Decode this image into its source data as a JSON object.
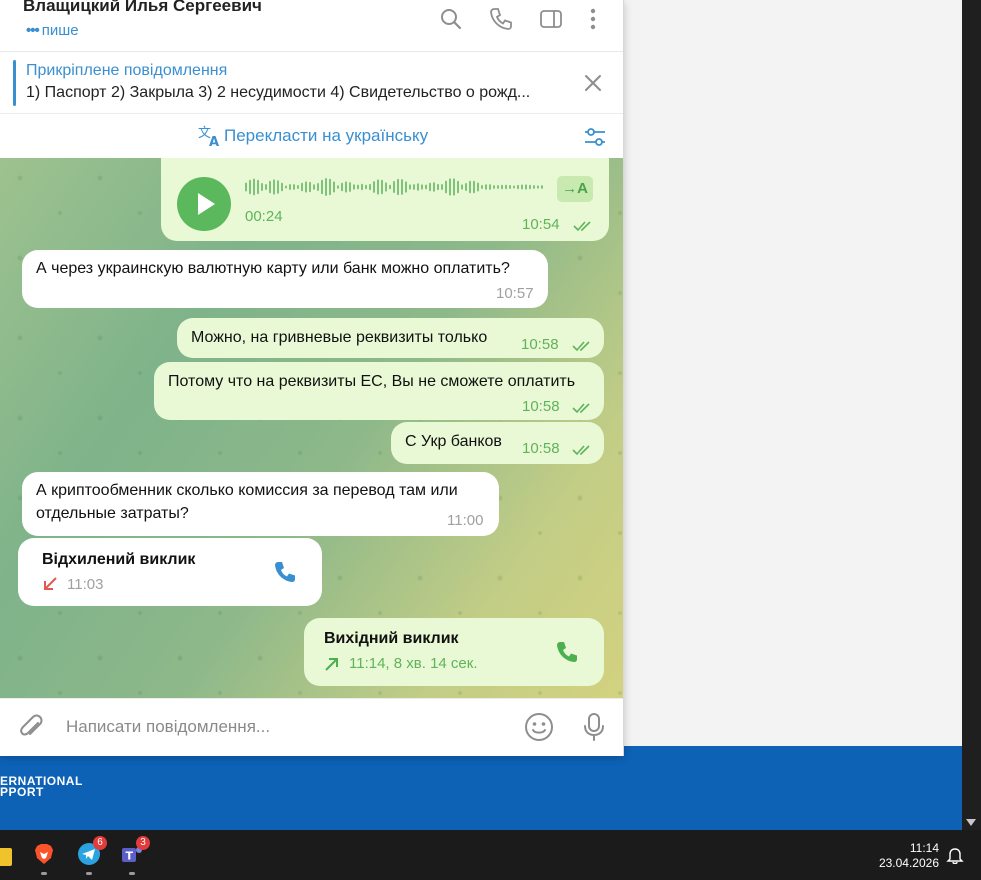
{
  "header": {
    "chat_name": "Влащицкий Илья Сергеевич",
    "status": "пише"
  },
  "pinned": {
    "title": "Прикріплене повідомлення",
    "text": "1) Паспорт 2) Закрыла 3) 2 несудимости 4) Свидетельство о рожд..."
  },
  "translate_bar": {
    "label": "Перекласти на українську"
  },
  "messages": [
    {
      "dir": "out",
      "type": "voice",
      "duration": "00:24",
      "time": "10:54",
      "transcribe": "→A"
    },
    {
      "dir": "in",
      "text": "А через украинскую валютную карту или банк можно оплатить?",
      "time": "10:57"
    },
    {
      "dir": "out",
      "text": "Можно, на гривневые реквизиты только",
      "time": "10:58"
    },
    {
      "dir": "out",
      "text": "Потому что на реквизиты ЕС, Вы не сможете оплатить",
      "time": "10:58"
    },
    {
      "dir": "out",
      "text": "С Укр банков",
      "time": "10:58"
    },
    {
      "dir": "in",
      "text_line1": "А криптообменник сколько комиссия за перевод там или",
      "text_line2": "отдельные затраты?",
      "time": "11:00"
    },
    {
      "dir": "in",
      "type": "call",
      "title": "Відхилений виклик",
      "meta": "11:03"
    },
    {
      "dir": "out",
      "type": "call",
      "title": "Вихідний виклик",
      "meta": "11:14, 8 хв. 14 сек."
    }
  ],
  "composer": {
    "placeholder": "Написати повідомлення..."
  },
  "background_page": {
    "logo_line1": "ERNATIONAL",
    "logo_line2": "PPORT"
  },
  "taskbar": {
    "telegram_badge": "6",
    "teams_badge": "3",
    "time": "11:14",
    "date": "23.04.2026"
  },
  "colors": {
    "accent": "#3a8fd1",
    "outgoing_bubble": "#e9f8d5",
    "outgoing_meta": "#5fb45a",
    "call_green": "#4caf50",
    "missed_red": "#e05a4f"
  }
}
